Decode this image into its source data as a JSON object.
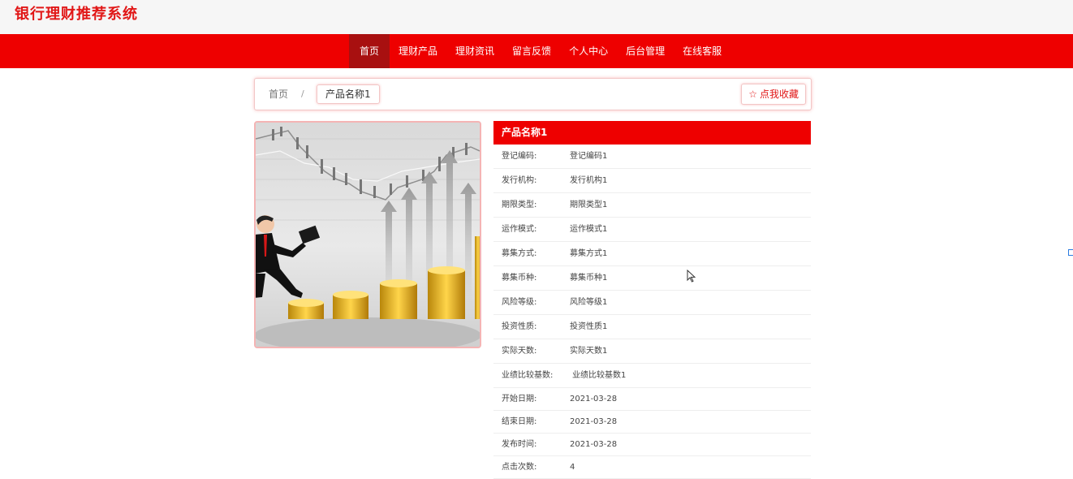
{
  "site": {
    "title": "银行理财推荐系统"
  },
  "nav": {
    "items": [
      {
        "label": "首页"
      },
      {
        "label": "理财产品"
      },
      {
        "label": "理财资讯"
      },
      {
        "label": "留言反馈"
      },
      {
        "label": "个人中心"
      },
      {
        "label": "后台管理"
      },
      {
        "label": "在线客服"
      }
    ],
    "active_index": 0
  },
  "breadcrumb": {
    "home": "首页",
    "separator": "/",
    "current": "产品名称1"
  },
  "favorite": {
    "icon": "star-outline-icon",
    "label": "点我收藏"
  },
  "product": {
    "name": "产品名称1",
    "image_alt": "stock-chart-coins-illustration",
    "fields": [
      {
        "key": "登记编码:",
        "value": "登记编码1"
      },
      {
        "key": "发行机构:",
        "value": "发行机构1"
      },
      {
        "key": "期限类型:",
        "value": "期限类型1"
      },
      {
        "key": "运作模式:",
        "value": "运作模式1"
      },
      {
        "key": "募集方式:",
        "value": "募集方式1"
      },
      {
        "key": "募集币种:",
        "value": "募集币种1"
      },
      {
        "key": "风险等级:",
        "value": "风险等级1"
      },
      {
        "key": "投资性质:",
        "value": "投资性质1"
      },
      {
        "key": "实际天数:",
        "value": "实际天数1"
      },
      {
        "key": "业绩比较基数:",
        "value": "业绩比较基数1"
      },
      {
        "key": "开始日期:",
        "value": "2021-03-28"
      },
      {
        "key": "结束日期:",
        "value": "2021-03-28"
      },
      {
        "key": "发布时间:",
        "value": "2021-03-28"
      },
      {
        "key": "点击次数:",
        "value": "4"
      }
    ]
  },
  "colors": {
    "brand_red": "#ee0000",
    "nav_active": "#a81010",
    "title_red": "#e11717"
  }
}
